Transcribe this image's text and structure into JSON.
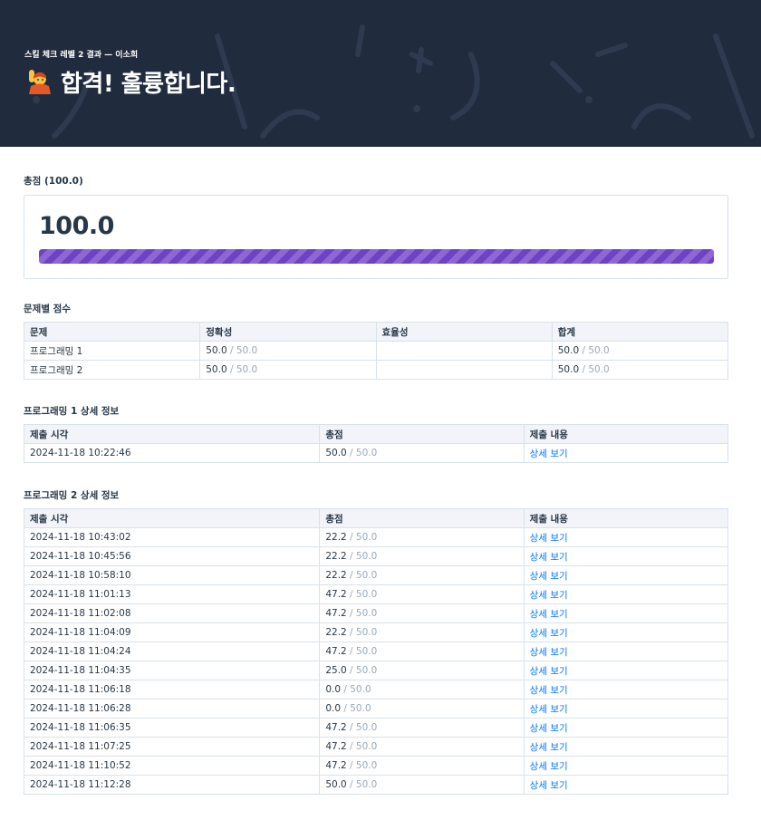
{
  "header": {
    "subtitle": "스킬 체크 레벨 2 결과 — 이소희",
    "emoji_icon": "person-raising-hand-icon",
    "title": "합격! 훌륭합니다."
  },
  "total_score": {
    "section_title": "총점 (100.0)",
    "value": "100.0",
    "fill_percent": 100,
    "bar_color": "#6f42c1"
  },
  "problem_scores": {
    "section_title": "문제별 점수",
    "columns": [
      "문제",
      "정확성",
      "효율성",
      "합계"
    ],
    "rows": [
      {
        "problem": "프로그래밍 1",
        "accuracy": "50.0",
        "accuracy_max": "50.0",
        "efficiency": "",
        "total": "50.0",
        "total_max": "50.0"
      },
      {
        "problem": "프로그래밍 2",
        "accuracy": "50.0",
        "accuracy_max": "50.0",
        "efficiency": "",
        "total": "50.0",
        "total_max": "50.0"
      }
    ]
  },
  "detail_sections": [
    {
      "section_title": "프로그래밍 1 상세 정보",
      "columns": [
        "제출 시각",
        "총점",
        "제출 내용"
      ],
      "rows": [
        {
          "time": "2024-11-18 10:22:46",
          "score": "50.0",
          "max": "50.0",
          "action": "상세 보기"
        }
      ]
    },
    {
      "section_title": "프로그래밍 2 상세 정보",
      "columns": [
        "제출 시각",
        "총점",
        "제출 내용"
      ],
      "rows": [
        {
          "time": "2024-11-18 10:43:02",
          "score": "22.2",
          "max": "50.0",
          "action": "상세 보기"
        },
        {
          "time": "2024-11-18 10:45:56",
          "score": "22.2",
          "max": "50.0",
          "action": "상세 보기"
        },
        {
          "time": "2024-11-18 10:58:10",
          "score": "22.2",
          "max": "50.0",
          "action": "상세 보기"
        },
        {
          "time": "2024-11-18 11:01:13",
          "score": "47.2",
          "max": "50.0",
          "action": "상세 보기"
        },
        {
          "time": "2024-11-18 11:02:08",
          "score": "47.2",
          "max": "50.0",
          "action": "상세 보기"
        },
        {
          "time": "2024-11-18 11:04:09",
          "score": "22.2",
          "max": "50.0",
          "action": "상세 보기"
        },
        {
          "time": "2024-11-18 11:04:24",
          "score": "47.2",
          "max": "50.0",
          "action": "상세 보기"
        },
        {
          "time": "2024-11-18 11:04:35",
          "score": "25.0",
          "max": "50.0",
          "action": "상세 보기"
        },
        {
          "time": "2024-11-18 11:06:18",
          "score": "0.0",
          "max": "50.0",
          "action": "상세 보기"
        },
        {
          "time": "2024-11-18 11:06:28",
          "score": "0.0",
          "max": "50.0",
          "action": "상세 보기"
        },
        {
          "time": "2024-11-18 11:06:35",
          "score": "47.2",
          "max": "50.0",
          "action": "상세 보기"
        },
        {
          "time": "2024-11-18 11:07:25",
          "score": "47.2",
          "max": "50.0",
          "action": "상세 보기"
        },
        {
          "time": "2024-11-18 11:10:52",
          "score": "47.2",
          "max": "50.0",
          "action": "상세 보기"
        },
        {
          "time": "2024-11-18 11:12:28",
          "score": "50.0",
          "max": "50.0",
          "action": "상세 보기"
        }
      ]
    }
  ],
  "colors": {
    "header_bg": "#202b3d",
    "link": "#0078ff",
    "muted": "#98a8b9",
    "text": "#263747"
  }
}
